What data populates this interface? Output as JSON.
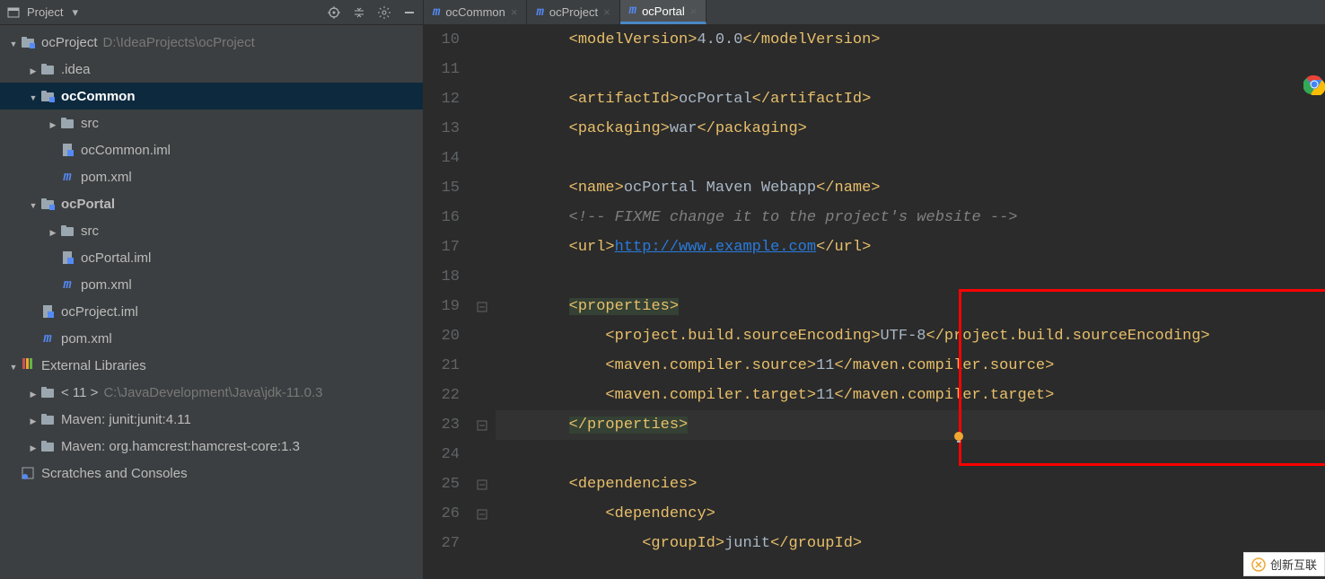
{
  "sidebar": {
    "title": "Project",
    "root": {
      "name": "ocProject",
      "path": "D:\\IdeaProjects\\ocProject"
    },
    "nodes": [
      {
        "indent": 0,
        "arrow": "down",
        "icon": "module",
        "label": "ocProject",
        "path": "D:\\IdeaProjects\\ocProject"
      },
      {
        "indent": 1,
        "arrow": "right",
        "icon": "folder",
        "label": ".idea"
      },
      {
        "indent": 1,
        "arrow": "down",
        "icon": "module",
        "label": "ocCommon",
        "selected": true,
        "bold": true
      },
      {
        "indent": 2,
        "arrow": "right",
        "icon": "folder",
        "label": "src"
      },
      {
        "indent": 2,
        "arrow": "none",
        "icon": "iml",
        "label": "ocCommon.iml"
      },
      {
        "indent": 2,
        "arrow": "none",
        "icon": "m",
        "label": "pom.xml"
      },
      {
        "indent": 1,
        "arrow": "down",
        "icon": "module",
        "label": "ocPortal",
        "bold": true
      },
      {
        "indent": 2,
        "arrow": "right",
        "icon": "folder",
        "label": "src"
      },
      {
        "indent": 2,
        "arrow": "none",
        "icon": "iml",
        "label": "ocPortal.iml"
      },
      {
        "indent": 2,
        "arrow": "none",
        "icon": "m",
        "label": "pom.xml"
      },
      {
        "indent": 1,
        "arrow": "none",
        "icon": "iml",
        "label": "ocProject.iml"
      },
      {
        "indent": 1,
        "arrow": "none",
        "icon": "m",
        "label": "pom.xml"
      },
      {
        "indent": 0,
        "arrow": "down",
        "icon": "lib",
        "label": "External Libraries"
      },
      {
        "indent": 1,
        "arrow": "right",
        "icon": "folder",
        "label": "< 11 >",
        "path": "C:\\JavaDevelopment\\Java\\jdk-11.0.3"
      },
      {
        "indent": 1,
        "arrow": "right",
        "icon": "folder",
        "label": "Maven: junit:junit:4.11"
      },
      {
        "indent": 1,
        "arrow": "right",
        "icon": "folder",
        "label": "Maven: org.hamcrest:hamcrest-core:1.3"
      },
      {
        "indent": 0,
        "arrow": "none",
        "icon": "scratch",
        "label": "Scratches and Consoles"
      }
    ]
  },
  "tabs": [
    {
      "label": "ocCommon",
      "active": false
    },
    {
      "label": "ocProject",
      "active": false
    },
    {
      "label": "ocPortal",
      "active": true
    }
  ],
  "code": {
    "startLine": 10,
    "lines": [
      {
        "n": 10,
        "html": "    <t>&lt;modelVersion&gt;</t><x>4.0.0</x><t>&lt;/modelVersion&gt;</t>"
      },
      {
        "n": 11,
        "html": ""
      },
      {
        "n": 12,
        "html": "    <t>&lt;artifactId&gt;</t><x>ocPortal</x><t>&lt;/artifactId&gt;</t>"
      },
      {
        "n": 13,
        "html": "    <t>&lt;packaging&gt;</t><x>war</x><t>&lt;/packaging&gt;</t>"
      },
      {
        "n": 14,
        "html": ""
      },
      {
        "n": 15,
        "html": "    <t>&lt;name&gt;</t><x>ocPortal Maven Webapp</x><t>&lt;/name&gt;</t>"
      },
      {
        "n": 16,
        "html": "    <c>&lt;!-- FIXME change it to the project's website --&gt;</c>"
      },
      {
        "n": 17,
        "html": "    <t>&lt;url&gt;</t><u>http://www.example.com</u><t>&lt;/url&gt;</t>"
      },
      {
        "n": 18,
        "html": ""
      },
      {
        "n": 19,
        "html": "    <g>&lt;properties&gt;</g>",
        "fold": "-"
      },
      {
        "n": 20,
        "html": "        <t>&lt;project.build.sourceEncoding&gt;</t><x>UTF-8</x><t>&lt;/project.build.sourceEncoding&gt;</t>"
      },
      {
        "n": 21,
        "html": "        <t>&lt;maven.compiler.source&gt;</t><x>11</x><t>&lt;/maven.compiler.source&gt;</t>"
      },
      {
        "n": 22,
        "html": "        <t>&lt;maven.compiler.target&gt;</t><x>11</x><t>&lt;/maven.compiler.target&gt;</t>"
      },
      {
        "n": 23,
        "html": "    <g>&lt;/properties&gt;</g>",
        "fold": "-",
        "hl": true
      },
      {
        "n": 24,
        "html": ""
      },
      {
        "n": 25,
        "html": "    <t>&lt;dependencies&gt;</t>",
        "fold": "-"
      },
      {
        "n": 26,
        "html": "        <t>&lt;dependency&gt;</t>",
        "fold": "-"
      },
      {
        "n": 27,
        "html": "            <t>&lt;groupId&gt;</t><x>junit</x><t>&lt;/groupId&gt;</t>"
      }
    ]
  },
  "watermark": "创新互联"
}
